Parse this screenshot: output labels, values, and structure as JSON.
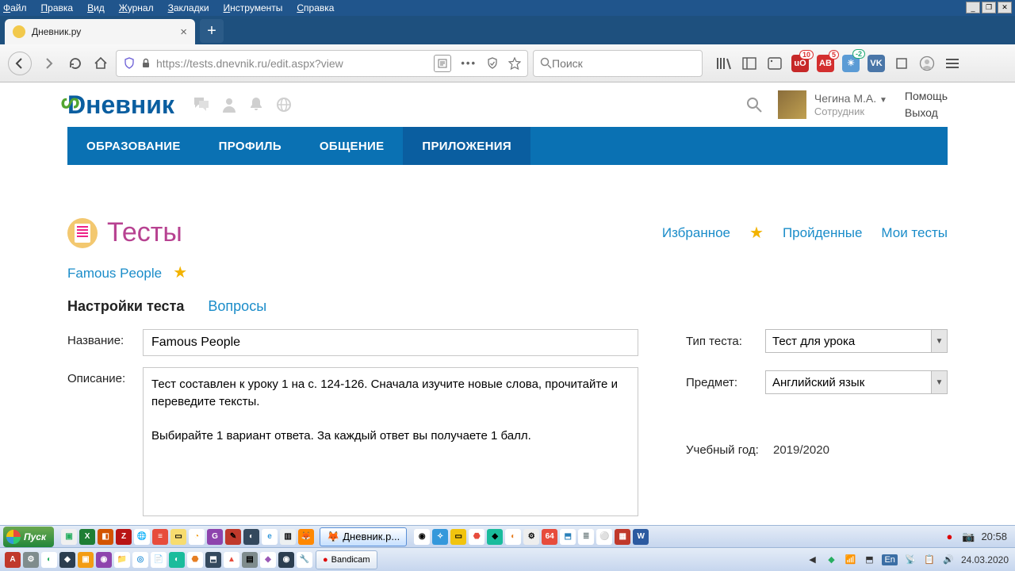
{
  "menubar": [
    "Файл",
    "Правка",
    "Вид",
    "Журнал",
    "Закладки",
    "Инструменты",
    "Справка"
  ],
  "tab": {
    "title": "Дневник.ру"
  },
  "url": "https://tests.dnevnik.ru/edit.aspx?view",
  "search_placeholder": "Поиск",
  "ext_badges": {
    "lib": "10",
    "abp": "5",
    "weather": "-2"
  },
  "site": {
    "logo": "невник",
    "user": {
      "name": "Чегина М.А.",
      "role": "Сотрудник"
    },
    "help": "Помощь",
    "exit": "Выход",
    "nav": [
      "ОБРАЗОВАНИЕ",
      "ПРОФИЛЬ",
      "ОБЩЕНИЕ",
      "ПРИЛОЖЕНИЯ"
    ]
  },
  "page": {
    "title": "Тесты",
    "links": {
      "fav": "Избранное",
      "passed": "Пройденные",
      "my": "Мои тесты"
    },
    "crumb": "Famous People",
    "tabs": {
      "settings": "Настройки теста",
      "questions": "Вопросы"
    },
    "labels": {
      "name": "Название:",
      "desc": "Описание:",
      "type": "Тип теста:",
      "subject": "Предмет:",
      "year": "Учебный год:"
    },
    "values": {
      "name": "Famous People",
      "desc": "Тест составлен к уроку 1 на с. 124-126. Сначала изучите новые слова, прочитайте и переведите тексты.\n\nВыбирайте 1 вариант ответа. За каждый ответ вы получаете 1 балл.",
      "type": "Тест для урока",
      "subject": "Английский язык",
      "year": "2019/2020"
    }
  },
  "taskbar": {
    "start": "Пуск",
    "active": "Дневник.р...",
    "bandicam": "Bandicam",
    "time": "20:58",
    "date": "24.03.2020",
    "lang": "En"
  }
}
